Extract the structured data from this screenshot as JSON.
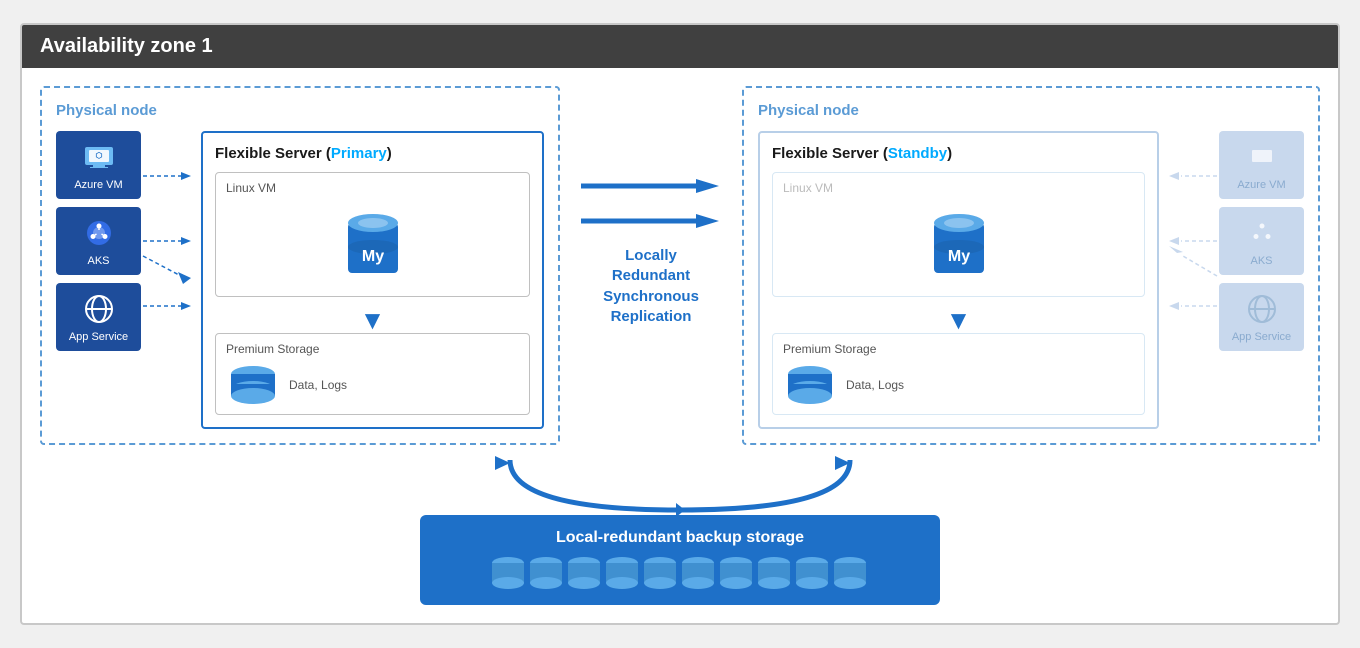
{
  "title": "Availability zone 1",
  "left_node": {
    "label": "Physical node",
    "server_title": "Flexible Server (",
    "server_title_colored": "Primary",
    "server_title_end": ")",
    "linux_vm_label": "Linux VM",
    "premium_storage_label": "Premium Storage",
    "data_logs_label": "Data, Logs",
    "icons": [
      {
        "name": "Azure VM",
        "type": "vm"
      },
      {
        "name": "AKS",
        "type": "aks"
      },
      {
        "name": "App Service",
        "type": "appservice"
      }
    ]
  },
  "right_node": {
    "label": "Physical node",
    "server_title": "Flexible Server (",
    "server_title_colored": "Standby",
    "server_title_end": ")",
    "linux_vm_label": "Linux VM",
    "premium_storage_label": "Premium Storage",
    "data_logs_label": "Data, Logs",
    "icons": [
      {
        "name": "Azure VM",
        "type": "vm"
      },
      {
        "name": "AKS",
        "type": "aks"
      },
      {
        "name": "App Service",
        "type": "appservice"
      }
    ]
  },
  "replication_label": "Locally\nRedundant\nSynchronous\nReplication",
  "backup_label": "Local-redundant backup storage",
  "colors": {
    "blue_dark": "#1e70c8",
    "blue_header": "#404040",
    "blue_light": "#5b9bd5",
    "blue_accent": "#00aaff",
    "faded": "#c8d8ed"
  }
}
